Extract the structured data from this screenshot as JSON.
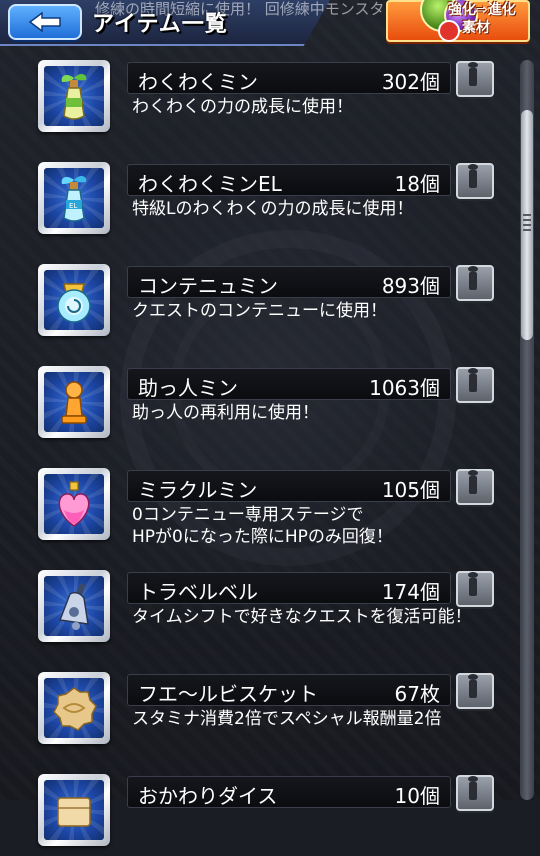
{
  "header": {
    "title": "アイテム一覧",
    "ticker": "修練の時間短縮に使用！ 回修練中モンスター",
    "back_icon": "back-arrow-icon",
    "evo_button": {
      "line1": "強化",
      "line2": "進化",
      "line3": "素材"
    }
  },
  "items": [
    {
      "name": "わくわくミン",
      "count": "302個",
      "desc": "わくわくの力の成長に使用！",
      "icon": "sprout-bottle-icon"
    },
    {
      "name": "わくわくミンEL",
      "count": "18個",
      "desc": "特級Lのわくわくの力の成長に使用！",
      "icon": "el-bottle-icon"
    },
    {
      "name": "コンテニュミン",
      "count": "893個",
      "desc": "クエストのコンテニューに使用！",
      "icon": "continue-jar-icon"
    },
    {
      "name": "助っ人ミン",
      "count": "1063個",
      "desc": "助っ人の再利用に使用！",
      "icon": "helper-pawn-icon"
    },
    {
      "name": "ミラクルミン",
      "count": "105個",
      "desc": "0コンテニュー専用ステージで\nHPが0になった際にHPのみ回復！",
      "icon": "heart-potion-icon"
    },
    {
      "name": "トラベルベル",
      "count": "174個",
      "desc": "タイムシフトで好きなクエストを復活可能！",
      "icon": "travel-bell-icon"
    },
    {
      "name": "フエ〜ルビスケット",
      "count": "67枚",
      "desc": "スタミナ消費2倍でスペシャル報酬量2倍",
      "icon": "biscuit-icon"
    },
    {
      "name": "おかわりダイス",
      "count": "10個",
      "desc": "",
      "icon": "dice-box-icon"
    }
  ]
}
